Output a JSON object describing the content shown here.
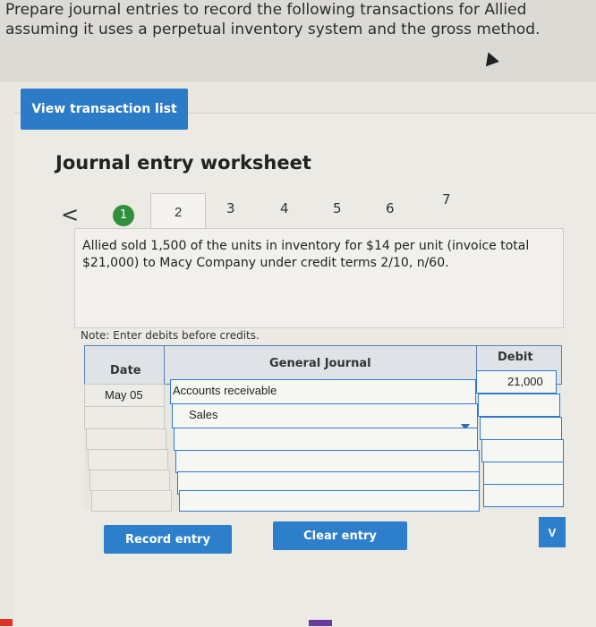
{
  "prompt": {
    "line1": "Prepare journal entries to record the following transactions for Allied",
    "line2": "assuming it uses a perpetual inventory system and the gross method."
  },
  "view_button": "View transaction list",
  "worksheet_title": "Journal entry worksheet",
  "nav": {
    "back": "<",
    "steps": [
      "1",
      "2",
      "3",
      "4",
      "5",
      "6",
      "7"
    ],
    "active_step": 1
  },
  "transaction_description": "Allied sold 1,500 of the units in inventory for $14 per unit (invoice total $21,000) to Macy Company under credit terms 2/10, n/60.",
  "note": "Note: Enter debits before credits.",
  "journal": {
    "headers": {
      "date": "Date",
      "general_journal": "General Journal",
      "debit": "Debit"
    },
    "rows": [
      {
        "date": "May 05",
        "account": "Accounts receivable",
        "debit": "21,000"
      },
      {
        "date": "",
        "account": "Sales",
        "debit": ""
      },
      {
        "date": "",
        "account": "",
        "debit": ""
      },
      {
        "date": "",
        "account": "",
        "debit": ""
      },
      {
        "date": "",
        "account": "",
        "debit": ""
      },
      {
        "date": "",
        "account": "",
        "debit": ""
      }
    ]
  },
  "buttons": {
    "record": "Record entry",
    "clear": "Clear entry",
    "next_partial": "V"
  },
  "icons": {
    "back": "chevron-left-icon",
    "dropdown": "dropdown-arrow-icon"
  },
  "colors": {
    "accent": "#2d7fcc",
    "step_active": "#2f8f3a"
  }
}
